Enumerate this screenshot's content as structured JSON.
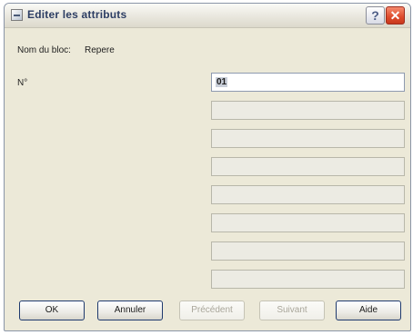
{
  "window": {
    "title": "Editer les attributs",
    "help_button": "?",
    "close_button": "✕"
  },
  "block": {
    "name_label": "Nom du bloc:",
    "name_value": "Repere"
  },
  "attributes": {
    "first_label": "N°",
    "first_value": "01"
  },
  "buttons": {
    "ok": "OK",
    "cancel": "Annuler",
    "previous": "Précédent",
    "next": "Suivant",
    "help": "Aide"
  },
  "colors": {
    "title_text": "#2c3d63",
    "close_button": "#dd4b2c",
    "dialog_background": "#ece9d8"
  }
}
